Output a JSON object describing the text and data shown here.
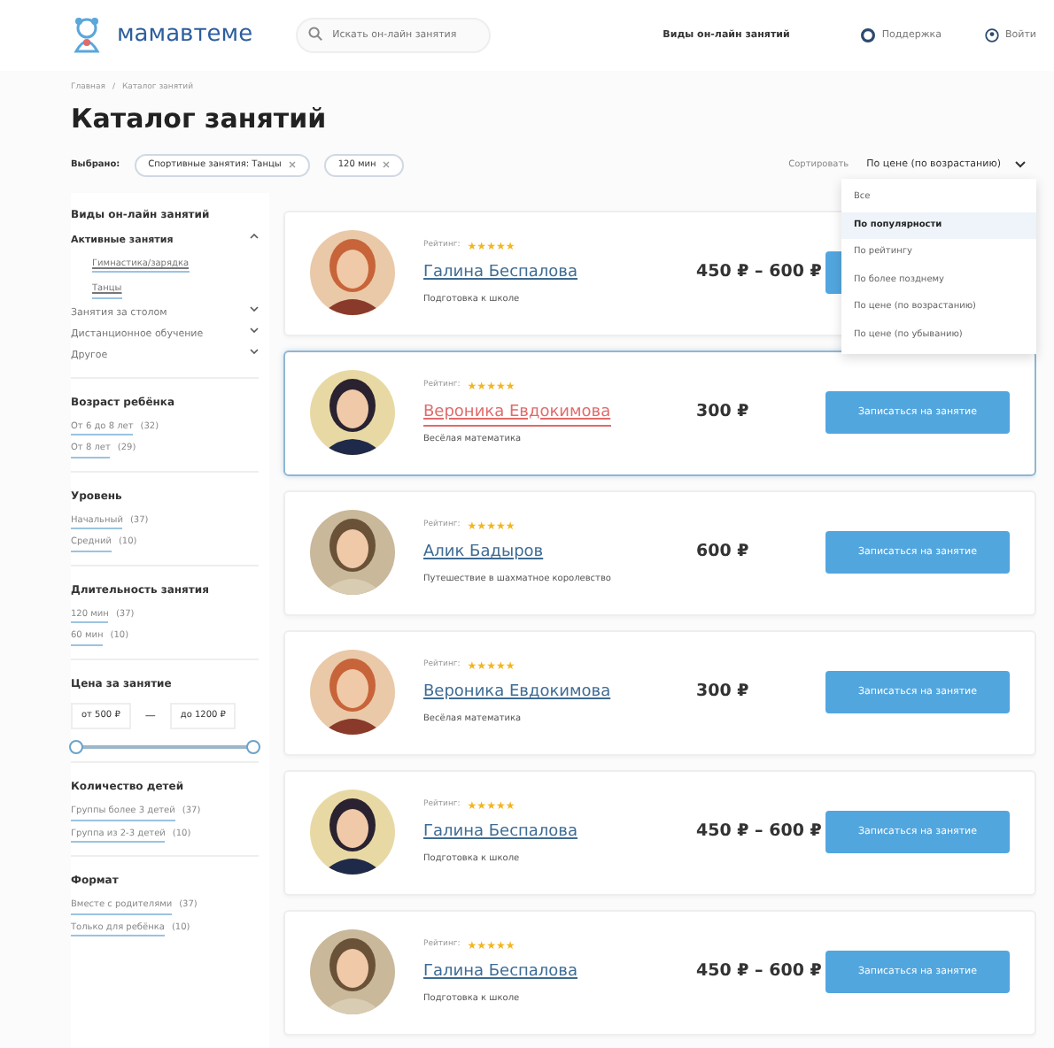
{
  "header": {
    "logo": "мамавтеме",
    "search": {
      "placeholder": "Искать он-лайн занятия"
    },
    "nav": [
      {
        "kind": "text",
        "label": "Виды он-лайн занятий"
      },
      {
        "kind": "support",
        "label": "Поддержка"
      },
      {
        "kind": "login",
        "label": "Войти"
      }
    ]
  },
  "breadcrumbs": {
    "items": [
      "Главная",
      "Каталог занятий"
    ],
    "separator": "/"
  },
  "title": "Каталог занятий",
  "filters": {
    "label": "Выбрано:",
    "chips": [
      "Спортивные занятия: Танцы",
      "120 мин"
    ]
  },
  "sort": {
    "label": "Сортировать",
    "value": "По цене (по возрастанию)",
    "expanded": true,
    "options": [
      {
        "label": "Все",
        "highlighted": false
      },
      {
        "label": "По популярности",
        "highlighted": true
      },
      {
        "label": "По рейтингу",
        "highlighted": false
      },
      {
        "label": "По более позднему",
        "highlighted": false
      },
      {
        "label": "По цене (по возрастанию)",
        "highlighted": false
      },
      {
        "label": "По цене (по убыванию)",
        "highlighted": false
      }
    ]
  },
  "sidebar": {
    "title": "Виды он-лайн занятий",
    "categories": [
      {
        "label": "Активные занятия",
        "expanded": true,
        "children": [
          "Гимнастика/зарядка",
          "Танцы"
        ]
      },
      {
        "label": "Занятия за столом",
        "expanded": false
      },
      {
        "label": "Дистанционное обучение",
        "expanded": false
      },
      {
        "label": "Другое",
        "expanded": false
      }
    ],
    "groups": [
      {
        "title": "Возраст ребёнка",
        "items": [
          {
            "label": "От 6 до 8 лет",
            "count": "(32)"
          },
          {
            "label": "От 8 лет",
            "count": "(29)"
          }
        ]
      },
      {
        "title": "Уровень",
        "items": [
          {
            "label": "Начальный",
            "count": "(37)"
          },
          {
            "label": "Средний",
            "count": "(10)"
          }
        ]
      },
      {
        "title": "Длительность занятия",
        "items": [
          {
            "label": "120 мин",
            "count": "(37)"
          },
          {
            "label": "60 мин",
            "count": "(10)"
          }
        ]
      },
      {
        "title": "Цена за занятие",
        "kind": "price",
        "from": "от 500 ₽",
        "dash": "—",
        "to": "до 1200 ₽",
        "level": 1
      },
      {
        "title": "Количество детей",
        "items": [
          {
            "label": "Группы более 3 детей",
            "count": "(37)"
          },
          {
            "label": "Группа из 2-3 детей",
            "count": "(10)"
          }
        ]
      },
      {
        "title": "Формат",
        "items": [
          {
            "label": "Вместе с родителями",
            "count": "(37)"
          },
          {
            "label": "Только для ребёнка",
            "count": "(10)"
          }
        ]
      }
    ]
  },
  "cards": [
    {
      "rating_label": "Рейтинг:",
      "stars": 5,
      "name": "Галина Беспалова",
      "subject": "Подготовка к школе",
      "price": "450 ₽ – 600 ₽",
      "selected": false
    },
    {
      "rating_label": "Рейтинг:",
      "stars": 5,
      "name": "Вероника Евдокимова",
      "subject": "Весёлая математика",
      "price": "300 ₽",
      "button": "Записаться на занятие",
      "selected": true
    },
    {
      "rating_label": "Рейтинг:",
      "stars": 5,
      "name": "Алик Бадыров",
      "subject": "Путешествие в шахматное королевство",
      "price": "600 ₽",
      "button": "Записаться на занятие",
      "selected": false
    },
    {
      "rating_label": "Рейтинг:",
      "stars": 5,
      "name": "Вероника Евдокимова",
      "subject": "Весёлая математика",
      "price": "300 ₽",
      "button": "Записаться на занятие",
      "selected": false
    },
    {
      "rating_label": "Рейтинг:",
      "stars": 5,
      "name": "Галина Беспалова",
      "subject": "Подготовка к школе",
      "price": "450 ₽ – 600 ₽",
      "button": "Записаться на занятие",
      "selected": false
    },
    {
      "rating_label": "Рейтинг:",
      "stars": 5,
      "name": "Галина Беспалова",
      "subject": "Подготовка к школе",
      "price": "450 ₽ – 600 ₽",
      "button": "Записаться на занятие",
      "selected": false
    }
  ]
}
